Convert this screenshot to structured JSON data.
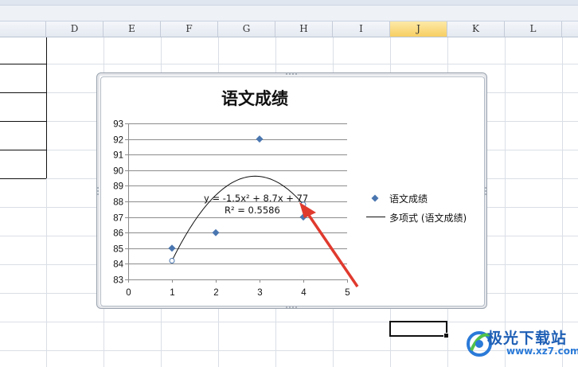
{
  "spreadsheet": {
    "columns": [
      "D",
      "E",
      "F",
      "G",
      "H",
      "I",
      "J",
      "K",
      "L"
    ],
    "selected_column": "J"
  },
  "chart_data": {
    "type": "scatter",
    "title": "语文成绩",
    "xlim": [
      0,
      5
    ],
    "ylim": [
      83,
      93
    ],
    "xticks": [
      0,
      1,
      2,
      3,
      4,
      5
    ],
    "yticks": [
      83,
      84,
      85,
      86,
      87,
      88,
      89,
      90,
      91,
      92,
      93
    ],
    "grid": "horizontal",
    "legend_position": "right",
    "series": [
      {
        "name": "语文成绩",
        "marker": "diamond",
        "color": "#4a76b0",
        "points": [
          [
            1,
            85
          ],
          [
            2,
            86
          ],
          [
            3,
            92
          ],
          [
            4,
            87
          ]
        ]
      }
    ],
    "trendline": {
      "name": "多项式 (语文成绩)",
      "type": "polynomial-2",
      "coefficients": [
        -1.5,
        8.7,
        77
      ],
      "x_range": [
        1,
        4
      ],
      "equation": "y = -1.5x² + 8.7x + 77",
      "r_squared": "R² = 0.5586"
    },
    "legend": [
      "语文成绩",
      "多项式 (语文成绩)"
    ],
    "annotation": "red-arrow"
  },
  "colors": {
    "marker": "#4a76b0",
    "arrow": "#e03a2e",
    "selected_column": "#f7cf62"
  },
  "watermark": {
    "text": "极光下载站",
    "url": "www.xz7.com"
  }
}
